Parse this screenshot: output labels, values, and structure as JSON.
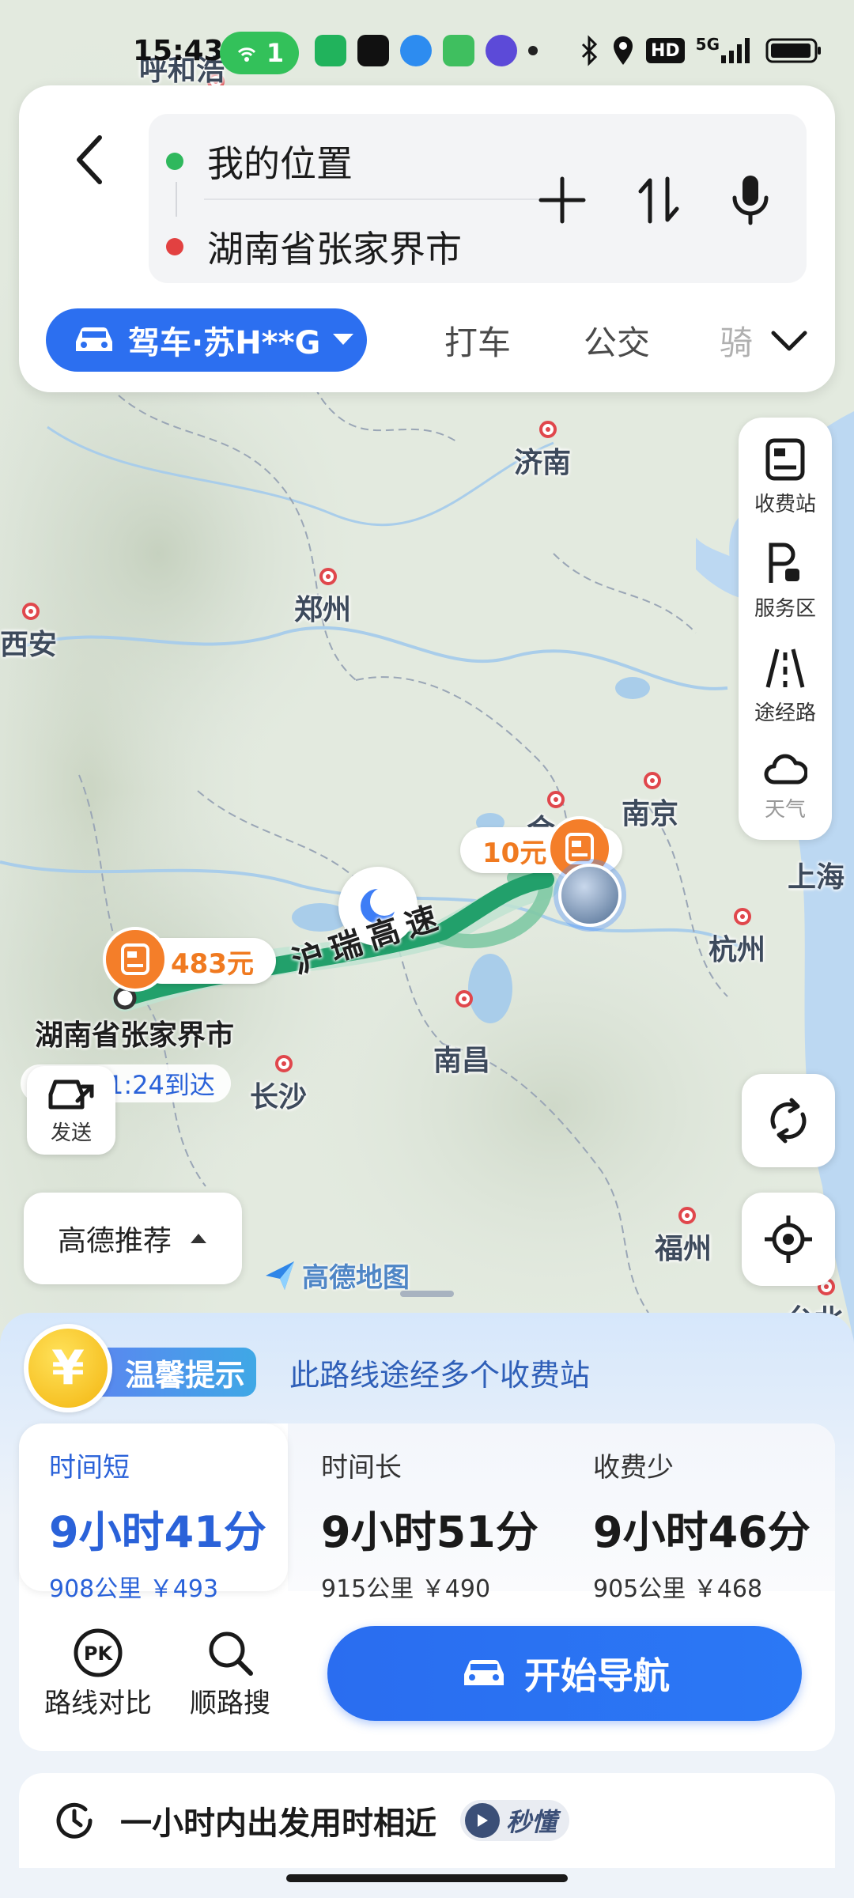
{
  "status_bar": {
    "time": "15:43",
    "hotspot_count": "1",
    "network": "5G"
  },
  "search": {
    "origin": "我的位置",
    "destination": "湖南省张家界市",
    "origin_color": "#2fb85d",
    "destination_color": "#e24141"
  },
  "mode_tabs": {
    "active": "驾车·苏H**G",
    "items": [
      "打车",
      "公交",
      "骑"
    ]
  },
  "map": {
    "cities": {
      "hohhot": "呼和浩",
      "jinan": "济南",
      "zhengzhou": "郑州",
      "xian": "西安",
      "nanjing": "南京",
      "hefei": "合",
      "shanghai": "上海",
      "hangzhou": "杭州",
      "nanchang": "南昌",
      "changsha": "长沙",
      "fuzhou": "福州",
      "taipei": "台北"
    },
    "toll_start": "10元",
    "toll_end": "483元",
    "road_name": "沪瑞高速",
    "destination_label": "湖南省张家界市",
    "eta": "1:24到达",
    "logo": "高德地图"
  },
  "tools": {
    "toll": "收费站",
    "service": "服务区",
    "roads": "途经路",
    "weather": "天气"
  },
  "send_label": "发送",
  "recommend_label": "高德推荐",
  "tip": {
    "tag": "温馨提示",
    "text": "此路线途经多个收费站",
    "coin": "¥"
  },
  "routes": [
    {
      "tag": "时间短",
      "time": "9小时41分",
      "meta": "908公里 ￥493"
    },
    {
      "tag": "时间长",
      "time": "9小时51分",
      "meta": "915公里 ￥490"
    },
    {
      "tag": "收费少",
      "time": "9小时46分",
      "meta": "905公里 ￥468"
    }
  ],
  "actions": {
    "compare": "路线对比",
    "search_along": "顺路搜",
    "start_nav": "开始导航"
  },
  "similar": {
    "text": "一小时内出发用时相近",
    "video": "秒懂"
  },
  "colors": {
    "accent": "#2c6ff0",
    "route_green": "#22a06b",
    "toll_orange": "#f47e29"
  }
}
